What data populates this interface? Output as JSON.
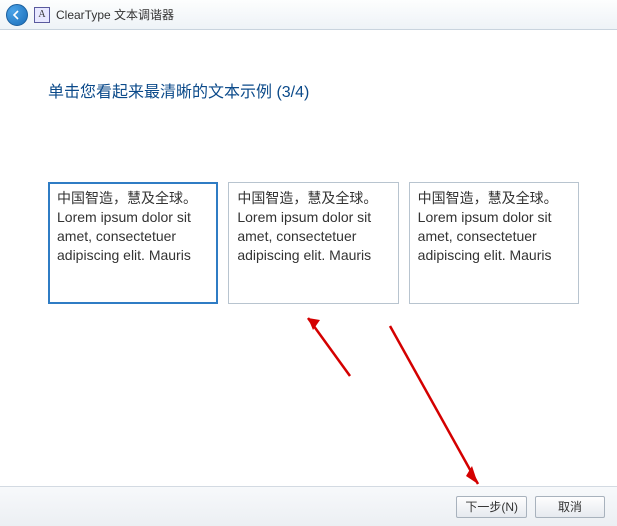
{
  "titlebar": {
    "app_icon_letter": "A",
    "title": "ClearType 文本调谐器"
  },
  "heading": "单击您看起来最清晰的文本示例 (3/4)",
  "sample_text": {
    "cn": "中国智造，慧及全球。",
    "en": "Lorem ipsum dolor sit amet, consectetuer adipiscing elit. Mauris"
  },
  "samples": [
    {
      "selected": true
    },
    {
      "selected": false
    },
    {
      "selected": false
    }
  ],
  "footer": {
    "next": "下一步(N)",
    "cancel": "取消"
  },
  "colors": {
    "heading": "#0b4a8a",
    "selection_border": "#2f7cc4",
    "annotation_arrow": "#d40000"
  }
}
